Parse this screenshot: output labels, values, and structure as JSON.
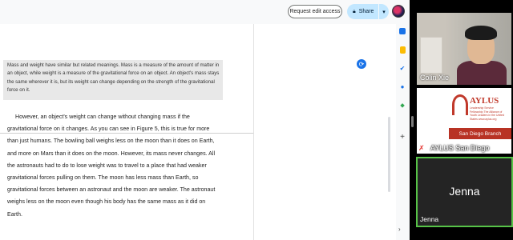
{
  "docs": {
    "request_edit_label": "Request edit access",
    "share_label": "Share",
    "quote_text": "Mass and weight have similar but related meanings. Mass is a measure of the amount of matter in an object, while weight is a measure of the gravitational force on an object. An object's mass stays the same wherever it is, but its weight can change depending on the strength of the gravitational force on it.",
    "body_text": "However, an object's weight can change without changing mass if the gravitational force on it changes. As you can see in Figure 5, this is true for more than just humans. The bowling ball weighs less on the moon than it does on Earth, and more on Mars than it does on the moon. However, its mass never changes. All the astronauts had to do to lose weight was to travel to a place that had weaker gravitational forces pulling on them. The moon has less mass than Earth, so gravitational forces between an astronaut and the moon are weaker. The astronaut weighs less on the moon even though his body has the same mass as it did on Earth."
  },
  "participants": {
    "colin": {
      "name": "Colin Xie"
    },
    "aylus": {
      "name": "AYLUS San Diego",
      "logo_word": "AYLUS",
      "logo_tagline": "Leadership Service Fellowship The Alliance of Youth Leaders in the United States www.aylus.org",
      "logo_branch": "San Diego Branch"
    },
    "jenna": {
      "display": "Jenna",
      "name": "Jenna"
    }
  },
  "icons": {
    "calendar": "calendar-icon",
    "keep": "keep-icon",
    "tasks": "tasks-icon",
    "contacts": "contacts-icon",
    "maps": "maps-icon",
    "add": "plus-icon"
  },
  "colors": {
    "share_bg": "#c2e7ff",
    "speaker_border": "#57c348",
    "aylus_red": "#b83224"
  }
}
